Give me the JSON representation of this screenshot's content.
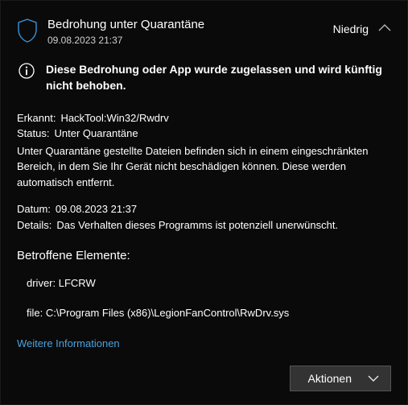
{
  "header": {
    "title": "Bedrohung unter Quarantäne",
    "timestamp": "09.08.2023 21:37",
    "severity": "Niedrig"
  },
  "info_message": "Diese Bedrohung oder App wurde zugelassen und wird künftig nicht behoben.",
  "detected": {
    "label": "Erkannt",
    "value": "HackTool:Win32/Rwdrv"
  },
  "status": {
    "label": "Status",
    "value": "Unter Quarantäne"
  },
  "quarantine_desc": "Unter Quarantäne gestellte Dateien befinden sich in einem eingeschränkten Bereich, in dem Sie Ihr Gerät nicht beschädigen können. Diese werden automatisch entfernt.",
  "date": {
    "label": "Datum",
    "value": "09.08.2023 21:37"
  },
  "details": {
    "label": "Details",
    "value": "Das Verhalten dieses Programms ist potenziell unerwünscht."
  },
  "affected": {
    "title": "Betroffene Elemente:",
    "items": [
      "driver: LFCRW",
      "file: C:\\Program Files (x86)\\LegionFanControl\\RwDrv.sys"
    ]
  },
  "more_info_link": "Weitere Informationen",
  "actions_button": "Aktionen",
  "colors": {
    "accent_link": "#4aa3df",
    "shield": "#3a93d6"
  }
}
